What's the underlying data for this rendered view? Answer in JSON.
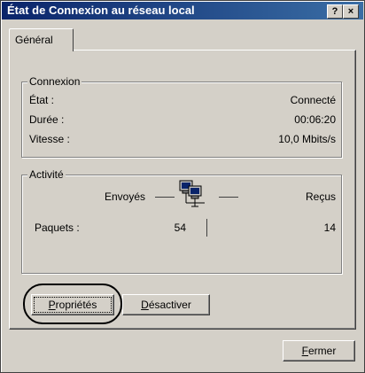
{
  "window": {
    "title": "État de Connexion au réseau local",
    "help_label": "?",
    "close_label": "×"
  },
  "tabs": [
    {
      "label": "Général"
    }
  ],
  "connexion": {
    "legend": "Connexion",
    "etat_label": "État :",
    "etat_value": "Connecté",
    "duree_label": "Durée :",
    "duree_value": "00:06:20",
    "vitesse_label": "Vitesse :",
    "vitesse_value": "10,0 Mbits/s"
  },
  "activite": {
    "legend": "Activité",
    "envoyes_label": "Envoyés",
    "recus_label": "Reçus",
    "paquets_label": "Paquets :",
    "paquets_envoyes": "54",
    "paquets_recus": "14",
    "network_icon": "network-computers-icon"
  },
  "buttons": {
    "proprietes": {
      "label_underlined": "P",
      "label_rest": "ropriétés"
    },
    "desactiver": {
      "label_underlined": "D",
      "label_rest": "ésactiver"
    },
    "fermer": {
      "label_underlined": "F",
      "label_rest": "ermer"
    }
  }
}
